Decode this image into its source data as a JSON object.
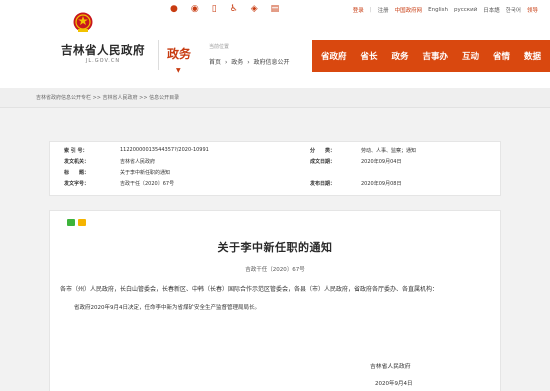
{
  "header": {
    "site_name": "吉林省人民政府",
    "site_url": "JL.GOV.CN",
    "section": "政务",
    "location_label": "当前位置",
    "breadcrumbs": [
      "首页",
      "›",
      "政务",
      "›",
      "政府信息公开"
    ],
    "social_icons": [
      "weibo-icon",
      "wechat-icon",
      "mobile-icon",
      "accessibility-icon",
      "elderly-icon",
      "bookmark-icon"
    ],
    "top_links": [
      {
        "label": "登录",
        "accent": true
      },
      {
        "label": "注册",
        "accent": false
      },
      {
        "label": "中国政府网",
        "accent": true
      },
      {
        "label": "English",
        "accent": false
      },
      {
        "label": "русский",
        "accent": false
      },
      {
        "label": "日本語",
        "accent": false
      },
      {
        "label": "한국어",
        "accent": false
      },
      {
        "label": "领导",
        "accent": true
      }
    ]
  },
  "nav": {
    "items": [
      "省政府",
      "省长",
      "政务",
      "吉事办",
      "互动",
      "省情",
      "数据"
    ],
    "color": "#d9480f"
  },
  "breadcrumb_bar": "吉林省政府信息公开专栏 >> 吉林省人民政府 >> 信息公开目录",
  "meta": {
    "index_label": "索 引 号：",
    "index_value": "11220000013544357?/2020-10991",
    "org_label": "发文机关：",
    "org_value": "吉林省人民政府",
    "subject_label": "标　　题：",
    "subject_value": "关于李中新任职的通知",
    "doc_no_label": "发文字号：",
    "doc_no_value": "吉政干任〔2020〕67号",
    "category_label": "分　　类：",
    "category_value": "劳动、人事、监察；通知",
    "created_label": "成文日期：",
    "created_value": "2020年09月04日",
    "published_label": "发布日期：",
    "published_value": "2020年09月08日"
  },
  "document": {
    "share_icons": [
      "wechat-share-icon",
      "qzone-share-icon"
    ],
    "title": "关于李中新任职的通知",
    "number": "吉政干任〔2020〕67号",
    "para1": "各市（州）人民政府，长白山管委会，长春新区、中韩（长春）国际合作示范区管委会，各县（市）人民政府，省政府各厅委办、各直属机构：",
    "para2": "省政府2020年9月4日决定，任命李中新为省煤矿安全生产监督管理局局长。",
    "signature": "吉林省人民政府",
    "date": "2020年9月4日"
  }
}
